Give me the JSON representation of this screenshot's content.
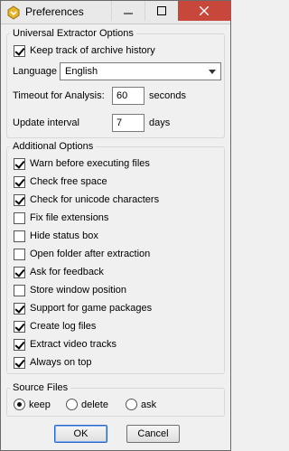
{
  "window": {
    "title": "Preferences"
  },
  "titlebar_buttons": {
    "minimize": "—",
    "maximize": "☐",
    "close": "✕"
  },
  "universal": {
    "legend": "Universal Extractor Options",
    "keep_history": {
      "label": "Keep track of archive history",
      "checked": true
    },
    "language_label": "Language",
    "language_value": "English",
    "timeout_label": "Timeout for Analysis:",
    "timeout_value": "60",
    "timeout_unit": "seconds",
    "update_label": "Update interval",
    "update_value": "7",
    "update_unit": "days"
  },
  "additional": {
    "legend": "Additional Options",
    "items": [
      {
        "label": "Warn before executing files",
        "checked": true
      },
      {
        "label": "Check free space",
        "checked": true
      },
      {
        "label": "Check for unicode characters",
        "checked": true
      },
      {
        "label": "Fix file extensions",
        "checked": false
      },
      {
        "label": "Hide status box",
        "checked": false
      },
      {
        "label": "Open folder after extraction",
        "checked": false
      },
      {
        "label": "Ask for feedback",
        "checked": true
      },
      {
        "label": "Store window position",
        "checked": false
      },
      {
        "label": "Support for game packages",
        "checked": true
      },
      {
        "label": "Create log files",
        "checked": true
      },
      {
        "label": "Extract video tracks",
        "checked": true
      },
      {
        "label": "Always on top",
        "checked": true
      }
    ]
  },
  "source_files": {
    "legend": "Source Files",
    "options": [
      {
        "label": "keep",
        "selected": true
      },
      {
        "label": "delete",
        "selected": false
      },
      {
        "label": "ask",
        "selected": false
      }
    ]
  },
  "buttons": {
    "ok": "OK",
    "cancel": "Cancel"
  }
}
